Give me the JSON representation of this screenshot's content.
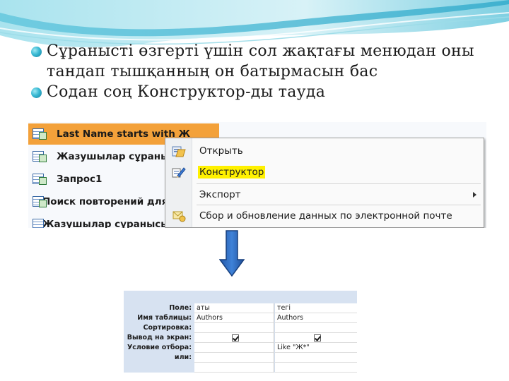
{
  "slide": {
    "bullets": [
      {
        "text": "Сұранысті өзгерті үшін сол жақтағы менюдан оны тандап тышқанның он батырмасын бас"
      },
      {
        "text": "Содан соң Конструктор-ды тауда"
      }
    ]
  },
  "nav": {
    "items": [
      {
        "label": "Last Name starts with Ж",
        "selected": true
      },
      {
        "label": "Жазушылар сұранысы",
        "selected": false
      },
      {
        "label": "Запрос1",
        "selected": false
      },
      {
        "label": "Поиск повторений для Auth...",
        "selected": false
      },
      {
        "label": "Жазушылар сұранысы_пере...",
        "selected": false
      }
    ]
  },
  "context_menu": {
    "items": [
      {
        "label": "Открыть",
        "icon": "open-icon"
      },
      {
        "label": "Конструктор",
        "icon": "design-view-icon",
        "highlighted": true
      },
      {
        "label": "Экспорт",
        "icon": "none",
        "submenu": true
      },
      {
        "label": "Сбор и обновление данных по электронной почте",
        "icon": "collect-data-icon"
      }
    ]
  },
  "query_grid": {
    "labels": {
      "field": "Поле:",
      "table": "Имя таблицы:",
      "sort": "Сортировка:",
      "show": "Вывод на экран:",
      "criteria": "Условие отбора:",
      "or": "или:"
    },
    "col1": {
      "field": "аты",
      "table": "Authors",
      "sort": "",
      "show": true,
      "criteria": "",
      "or": ""
    },
    "col2": {
      "field": "тегі",
      "table": "Authors",
      "sort": "",
      "show": true,
      "criteria": "Like \"Ж*\"",
      "or": ""
    }
  },
  "colors": {
    "selected_row": "#f3a13a",
    "highlight": "#fff100",
    "arrow": "#2f6fbf",
    "bullet": "#38b9d3",
    "grid_bg": "#d7e2f1"
  }
}
